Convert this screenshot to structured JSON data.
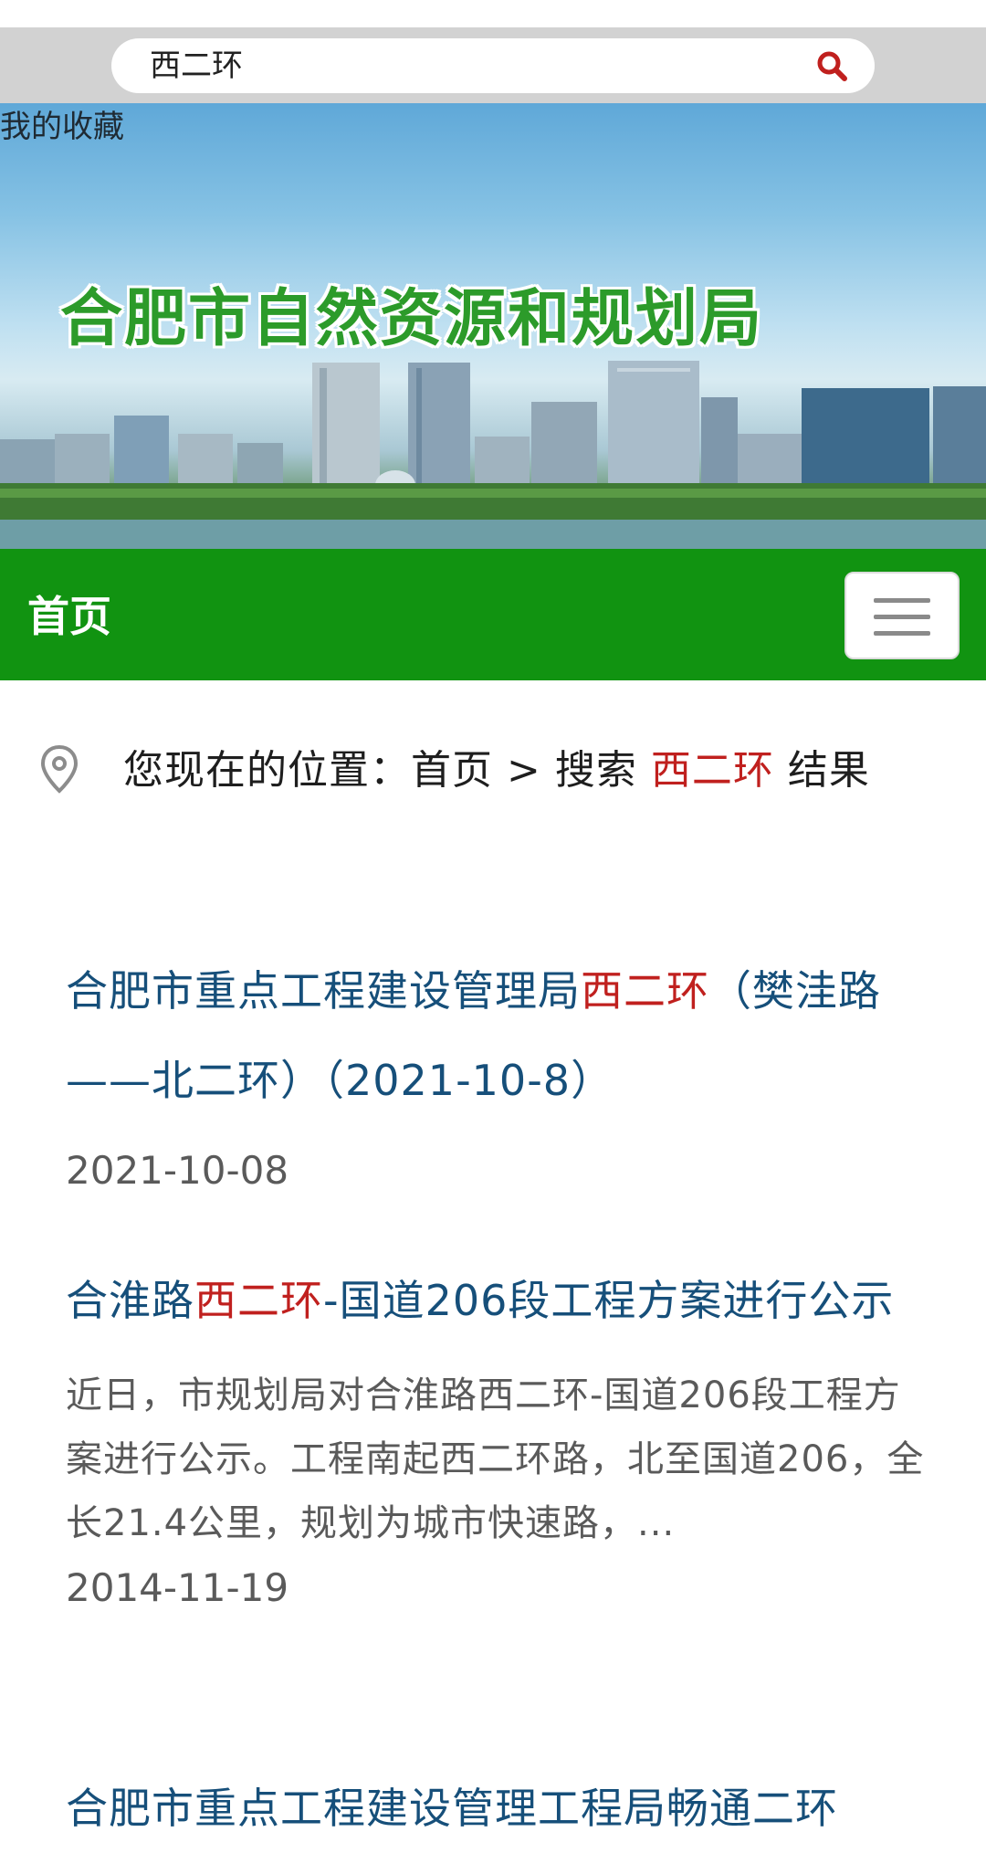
{
  "search": {
    "query": "西二环"
  },
  "banner": {
    "favorites": "我的收藏",
    "title": "合肥市自然资源和规划局"
  },
  "nav": {
    "home": "首页"
  },
  "breadcrumb": {
    "prefix": "您现在的位置：首页 > 搜索 ",
    "keyword": "西二环",
    "suffix": " 结果"
  },
  "results": [
    {
      "title_pre": "合肥市重点工程建设管理局",
      "title_hl": "西二环",
      "title_post": "（樊洼路——北二环）（2021-10-8）",
      "date": "2021-10-08"
    },
    {
      "title_pre": "合淮路",
      "title_hl": "西二环",
      "title_post": "-国道206段工程方案进行公示",
      "snippet": "近日，市规划局对合淮路西二环-国道206段工程方案进行公示。工程南起西二环路，北至国道206，全长21.4公里，规划为城市快速路，...",
      "date": "2014-11-19"
    },
    {
      "title_pre": "合肥市重点工程建设管理工程局畅通二环"
    }
  ],
  "colors": {
    "nav_green": "#119311",
    "title_blue": "#164f7a",
    "highlight_red": "#c0201e"
  },
  "icons": [
    "search-icon",
    "location-pin-icon",
    "menu-icon"
  ]
}
